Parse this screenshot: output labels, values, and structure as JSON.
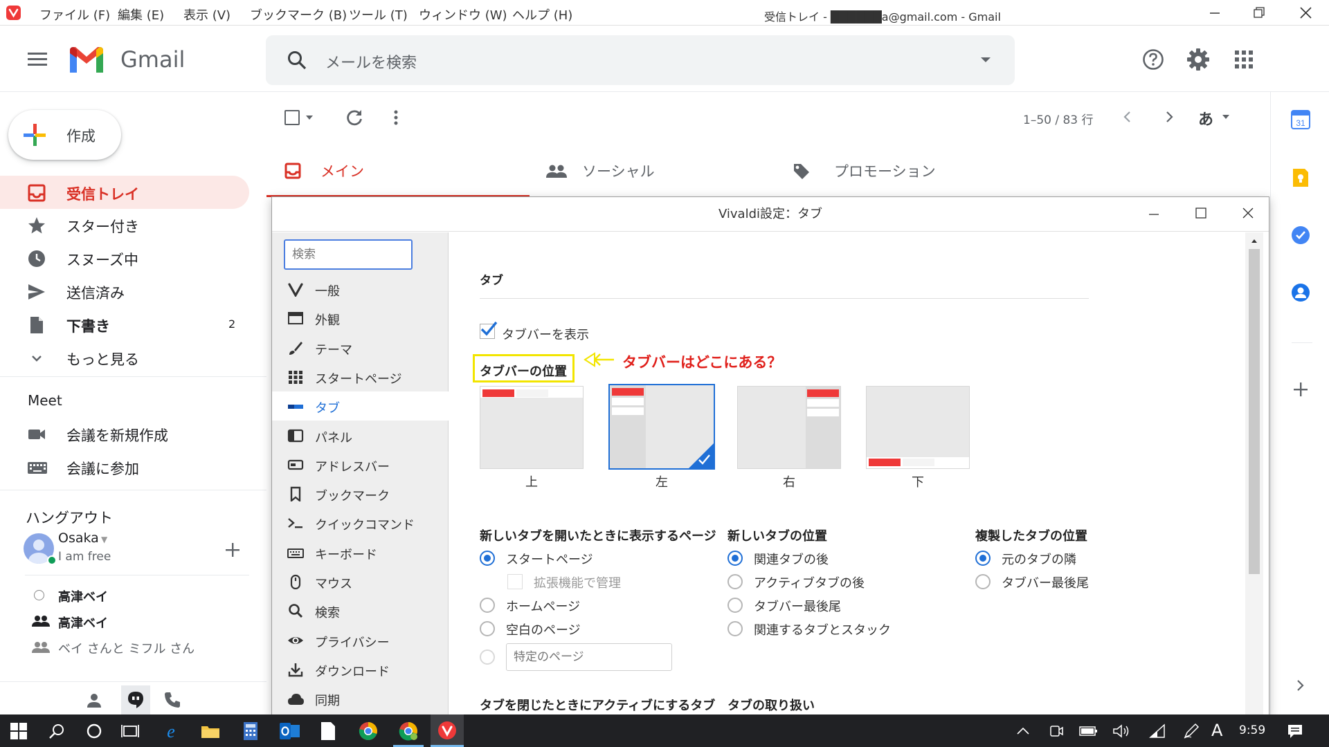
{
  "window": {
    "title": "受信トレイ - ██████a@gmail.com - Gmail",
    "menu": [
      "ファイル (F)",
      "編集 (E)",
      "表示 (V)",
      "ブックマーク (B)",
      "ツール (T)",
      "ウィンドウ (W)",
      "ヘルプ (H)"
    ]
  },
  "gmail": {
    "logo_text": "Gmail",
    "search_placeholder": "メールを検索",
    "compose_label": "作成",
    "nav": [
      {
        "label": "受信トレイ",
        "icon": "inbox-icon",
        "count": ""
      },
      {
        "label": "スター付き",
        "icon": "star-icon",
        "count": ""
      },
      {
        "label": "スヌーズ中",
        "icon": "clock-icon",
        "count": ""
      },
      {
        "label": "送信済み",
        "icon": "send-icon",
        "count": ""
      },
      {
        "label": "下書き",
        "icon": "draft-icon",
        "count": "2"
      },
      {
        "label": "もっと見る",
        "icon": "chevron-down-icon",
        "count": ""
      }
    ],
    "meet": {
      "title": "Meet",
      "items": [
        "会議を新規作成",
        "会議に参加"
      ]
    },
    "hangouts": {
      "title": "ハングアウト",
      "user_name": "Osaka",
      "user_status": "I am free",
      "contacts": [
        "高津ベイ",
        "高津ベイ",
        "ベイ さんと ミフル さん"
      ]
    },
    "pagination": "1–50 / 83 行",
    "input_tool": "あ",
    "tabs": [
      "メイン",
      "ソーシャル",
      "プロモーション"
    ]
  },
  "dialog": {
    "title": "Vivaldi設定：タブ",
    "search_placeholder": "検索",
    "sidebar": [
      {
        "label": "一般",
        "icon": "vivaldi-icon"
      },
      {
        "label": "外観",
        "icon": "window-icon"
      },
      {
        "label": "テーマ",
        "icon": "brush-icon"
      },
      {
        "label": "スタートページ",
        "icon": "grid-icon"
      },
      {
        "label": "タブ",
        "icon": "tab-icon"
      },
      {
        "label": "パネル",
        "icon": "panel-icon"
      },
      {
        "label": "アドレスバー",
        "icon": "addressbar-icon"
      },
      {
        "label": "ブックマーク",
        "icon": "bookmark-icon"
      },
      {
        "label": "クイックコマンド",
        "icon": "command-icon"
      },
      {
        "label": "キーボード",
        "icon": "keyboard-icon"
      },
      {
        "label": "マウス",
        "icon": "mouse-icon"
      },
      {
        "label": "検索",
        "icon": "search-icon"
      },
      {
        "label": "プライバシー",
        "icon": "eye-icon"
      },
      {
        "label": "ダウンロード",
        "icon": "download-icon"
      },
      {
        "label": "同期",
        "icon": "cloud-icon"
      }
    ],
    "active_sidebar": "タブ",
    "section_title": "タブ",
    "show_tabbar_label": "タブバーを表示",
    "show_tabbar_checked": true,
    "position_heading": "タブバーの位置",
    "annotation": "タブバーはどこにある？",
    "annotation_color": "#e0201b",
    "highlight_color": "#f2e500",
    "positions": [
      {
        "label": "上",
        "selected": false
      },
      {
        "label": "左",
        "selected": true
      },
      {
        "label": "右",
        "selected": false
      },
      {
        "label": "下",
        "selected": false
      }
    ],
    "new_tab_page": {
      "heading": "新しいタブを開いたときに表示するページ",
      "options": [
        "スタートページ",
        "ホームページ",
        "空白のページ"
      ],
      "selected": "スタートページ",
      "ext_manage_label": "拡張機能で管理",
      "specific_placeholder": "特定のページ"
    },
    "new_tab_position": {
      "heading": "新しいタブの位置",
      "options": [
        "関連タブの後",
        "アクティブタブの後",
        "タブバー最後尾",
        "関連するタブとスタック"
      ],
      "selected": "関連タブの後"
    },
    "dup_tab_position": {
      "heading": "複製したタブの位置",
      "options": [
        "元のタブの隣",
        "タブバー最後尾"
      ],
      "selected": "元のタブの隣"
    },
    "close_heading": "タブを閉じたときにアクティブにするタブ",
    "handling_heading": "タブの取り扱い"
  },
  "taskbar": {
    "time": "9:59",
    "ime": "A"
  },
  "colors": {
    "vivaldi_red": "#ef3939",
    "gmail_red": "#d93025",
    "accent_blue": "#1f6fd6"
  }
}
